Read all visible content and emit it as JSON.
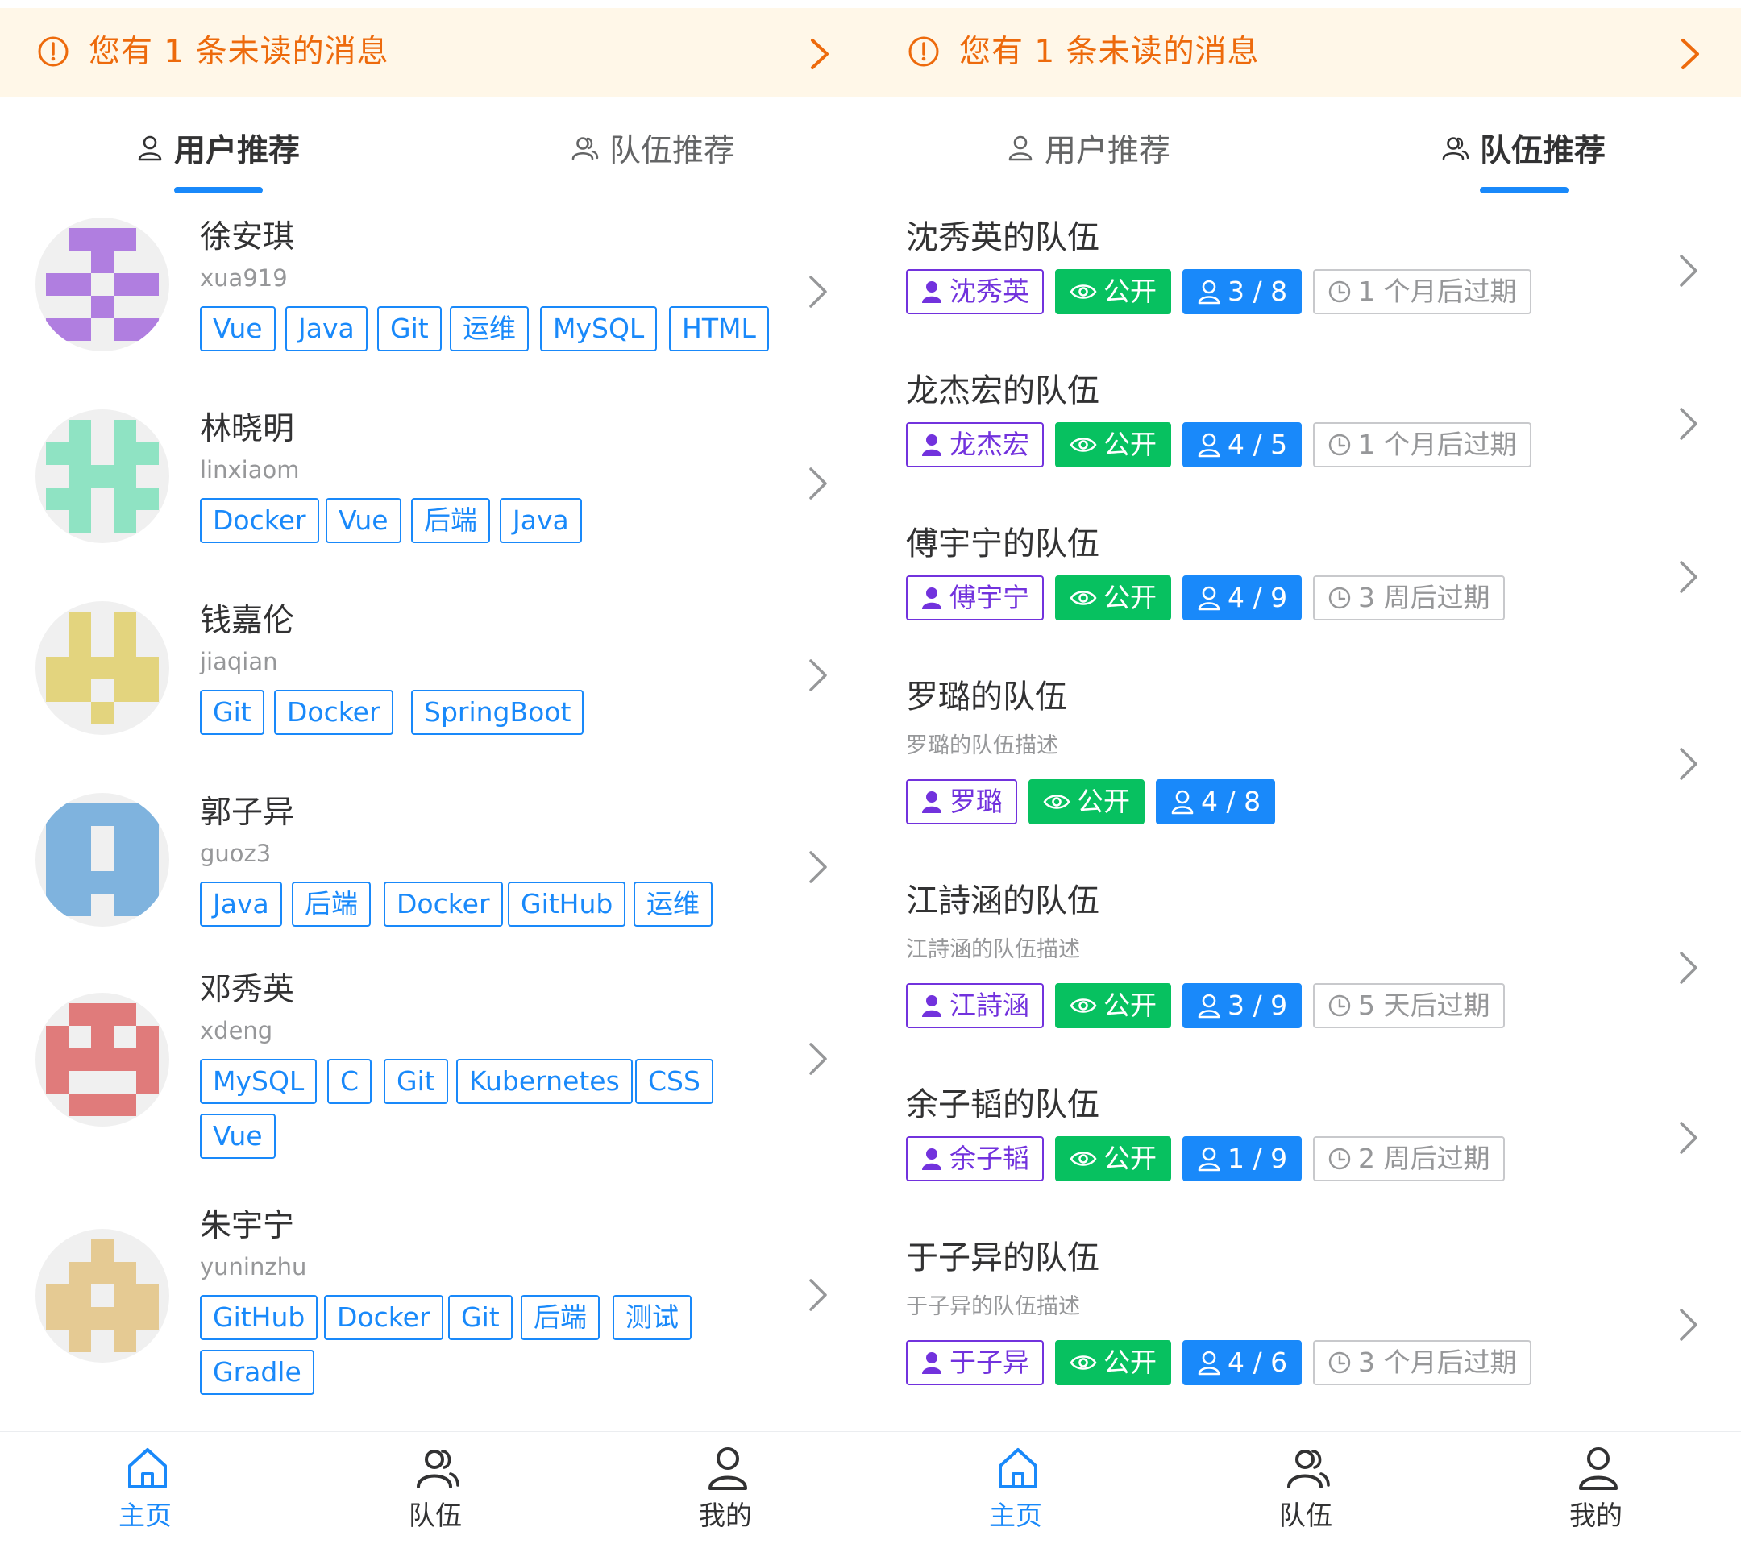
{
  "notice": {
    "text": "您有 1 条未读的消息"
  },
  "tabs": {
    "user_label": "用户推荐",
    "team_label": "队伍推荐"
  },
  "tabbar": {
    "home": "主页",
    "team": "队伍",
    "mine": "我的"
  },
  "colors": {
    "primary": "#1989fa",
    "warning": "#ed6a0c",
    "notice_bg": "#fff7e8",
    "success": "#07c160",
    "purple": "#7232dd"
  },
  "left_panel": {
    "active_tab": "user"
  },
  "right_panel": {
    "active_tab": "team"
  },
  "users": [
    {
      "name": "徐安琪",
      "account": "xua919",
      "avatar_color": "#b07ee0",
      "avatar_icon": "identicon-purple",
      "tags": [
        "Vue",
        "Java",
        "Git",
        "运维",
        "MySQL",
        "HTML"
      ]
    },
    {
      "name": "林晓明",
      "account": "linxiaom",
      "avatar_color": "#8fe3c3",
      "avatar_icon": "identicon-mint",
      "tags": [
        "Docker",
        "Vue",
        "后端",
        "Java"
      ]
    },
    {
      "name": "钱嘉伦",
      "account": "jiaqian",
      "avatar_color": "#e3d47e",
      "avatar_icon": "identicon-yellow",
      "tags": [
        "Git",
        "Docker",
        "SpringBoot"
      ]
    },
    {
      "name": "郭子异",
      "account": "guoz3",
      "avatar_color": "#7fb3de",
      "avatar_icon": "identicon-blue",
      "tags": [
        "Java",
        "后端",
        "Docker",
        "GitHub",
        "运维"
      ]
    },
    {
      "name": "邓秀英",
      "account": "xdeng",
      "avatar_color": "#e07b7b",
      "avatar_icon": "identicon-red",
      "tags": [
        "MySQL",
        "C",
        "Git",
        "Kubernetes",
        "CSS",
        "Vue"
      ]
    },
    {
      "name": "朱宇宁",
      "account": "yuninzhu",
      "avatar_color": "#e5ca93",
      "avatar_icon": "identicon-tan",
      "tags": [
        "GitHub",
        "Docker",
        "Git",
        "后端",
        "测试",
        "Gradle"
      ]
    }
  ],
  "teams": [
    {
      "name": "沈秀英的队伍",
      "desc": "",
      "owner": "沈秀英",
      "status": "公开",
      "count": "3 / 8",
      "expire": "1 个月后过期"
    },
    {
      "name": "龙杰宏的队伍",
      "desc": "",
      "owner": "龙杰宏",
      "status": "公开",
      "count": "4 / 5",
      "expire": "1 个月后过期"
    },
    {
      "name": "傅宇宁的队伍",
      "desc": "",
      "owner": "傅宇宁",
      "status": "公开",
      "count": "4 / 9",
      "expire": "3 周后过期"
    },
    {
      "name": "罗璐的队伍",
      "desc": "罗璐的队伍描述",
      "owner": "罗璐",
      "status": "公开",
      "count": "4 / 8",
      "expire": ""
    },
    {
      "name": "江詩涵的队伍",
      "desc": "江詩涵的队伍描述",
      "owner": "江詩涵",
      "status": "公开",
      "count": "3 / 9",
      "expire": "5 天后过期"
    },
    {
      "name": "余子韬的队伍",
      "desc": "",
      "owner": "余子韬",
      "status": "公开",
      "count": "1 / 9",
      "expire": "2 周后过期"
    },
    {
      "name": "于子异的队伍",
      "desc": "于子异的队伍描述",
      "owner": "于子异",
      "status": "公开",
      "count": "4 / 6",
      "expire": "3 个月后过期"
    }
  ]
}
